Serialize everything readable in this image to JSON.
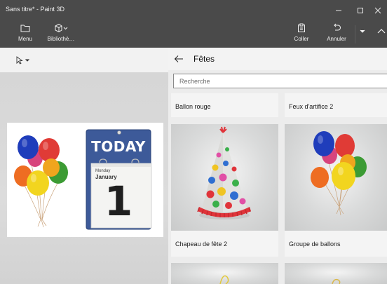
{
  "window": {
    "title": "Sans titre* - Paint 3D",
    "controls": [
      "minimize-icon",
      "maximize-icon",
      "close-icon"
    ]
  },
  "toolbar": {
    "left": [
      {
        "label": "Menu",
        "icon": "folder-icon"
      },
      {
        "label": "Bibliothè…",
        "icon": "library-icon"
      }
    ],
    "right": [
      {
        "label": "Coller",
        "icon": "paste-icon"
      },
      {
        "label": "Annuler",
        "icon": "undo-icon"
      }
    ]
  },
  "left_tools": {
    "select_icon": "cursor-select-icon"
  },
  "canvas": {
    "calendar": {
      "banner": "TODAY",
      "weekday": "Monday",
      "month": "January",
      "day": "1"
    }
  },
  "library": {
    "title": "Fêtes",
    "search_placeholder": "Recherche",
    "items": [
      {
        "label": "Ballon rouge"
      },
      {
        "label": "Feux d'artifice 2"
      },
      {
        "label": "Chapeau de fête 2"
      },
      {
        "label": "Groupe de ballons"
      }
    ]
  },
  "colors": {
    "titlebar": "#4a4a4a",
    "panel": "#ececec",
    "calendar_blue": "#3d5a99"
  }
}
